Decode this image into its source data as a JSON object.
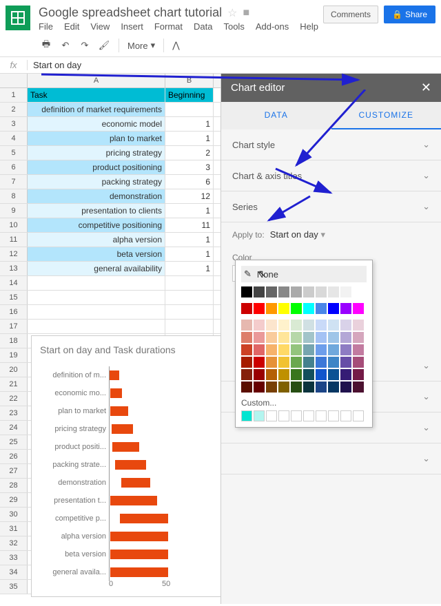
{
  "doc": {
    "title": "Google spreadsheet chart tutorial"
  },
  "menubar": {
    "file": "File",
    "edit": "Edit",
    "view": "View",
    "insert": "Insert",
    "format": "Format",
    "data": "Data",
    "tools": "Tools",
    "addons": "Add-ons",
    "help": "Help"
  },
  "buttons": {
    "comments": "Comments",
    "share": "Share"
  },
  "toolbar": {
    "more": "More"
  },
  "fx": {
    "value": "Start on day"
  },
  "columns": {
    "a": "A",
    "b": "B"
  },
  "table": {
    "header": {
      "task": "Task",
      "beginning": "Beginning"
    },
    "rows": [
      {
        "task": "definition of market requirements",
        "beg": ""
      },
      {
        "task": "economic model",
        "beg": "1"
      },
      {
        "task": "plan to market",
        "beg": "1"
      },
      {
        "task": "pricing strategy",
        "beg": "2"
      },
      {
        "task": "product positioning",
        "beg": "3"
      },
      {
        "task": "packing strategy",
        "beg": "6"
      },
      {
        "task": "demonstration",
        "beg": "12"
      },
      {
        "task": "presentation to clients",
        "beg": "1"
      },
      {
        "task": "competitive positioning",
        "beg": "11"
      },
      {
        "task": "alpha version",
        "beg": "1"
      },
      {
        "task": "beta version",
        "beg": "1"
      },
      {
        "task": "general availability",
        "beg": "1"
      }
    ]
  },
  "chart_data": {
    "type": "bar",
    "title": "Start on day and Task durations",
    "categories": [
      "definition of m...",
      "economic mo...",
      "plan to market",
      "pricing strategy",
      "product positi...",
      "packing strate...",
      "demonstration",
      "presentation t...",
      "competitive p...",
      "alpha version",
      "beta version",
      "general availa..."
    ],
    "series": [
      {
        "name": "Start on day",
        "values": [
          0,
          1,
          1,
          2,
          3,
          6,
          12,
          1,
          11,
          1,
          1,
          1
        ]
      },
      {
        "name": "Task durations",
        "values": [
          10,
          12,
          18,
          22,
          28,
          32,
          30,
          48,
          50,
          60,
          60,
          60
        ]
      }
    ],
    "xlabel": "",
    "ylabel": "",
    "xlim": [
      0,
      100
    ],
    "xticks": [
      "0",
      "50"
    ]
  },
  "editor": {
    "title": "Chart editor",
    "tabs": {
      "data": "DATA",
      "customize": "CUSTOMIZE"
    },
    "sections": {
      "chart_style": "Chart style",
      "axis_titles": "Chart & axis titles",
      "series": "Series"
    },
    "apply_to_label": "Apply to:",
    "apply_to_value": "Start on day",
    "color_label": "Color",
    "color_value": "None",
    "collapsed": [
      "",
      "",
      "",
      ""
    ]
  },
  "color_picker": {
    "none": "None",
    "custom": "Custom...",
    "grays": [
      "#000000",
      "#444444",
      "#666666",
      "#888888",
      "#aaaaaa",
      "#cccccc",
      "#d9d9d9",
      "#e6e6e6",
      "#f2f2f2",
      "#ffffff"
    ],
    "main": [
      "#cc0000",
      "#ff0000",
      "#ff9900",
      "#ffff00",
      "#00ff00",
      "#00ffff",
      "#4a86e8",
      "#0000ff",
      "#9900ff",
      "#ff00ff"
    ],
    "tints": [
      [
        "#e6b8af",
        "#f4cccc",
        "#fce5cd",
        "#fff2cc",
        "#d9ead3",
        "#d0e0e3",
        "#c9daf8",
        "#cfe2f3",
        "#d9d2e9",
        "#ead1dc"
      ],
      [
        "#dd7e6b",
        "#ea9999",
        "#f9cb9c",
        "#ffe599",
        "#b6d7a8",
        "#a2c4c9",
        "#a4c2f4",
        "#9fc5e8",
        "#b4a7d6",
        "#d5a6bd"
      ],
      [
        "#cc4125",
        "#e06666",
        "#f6b26b",
        "#ffd966",
        "#93c47d",
        "#76a5af",
        "#6d9eeb",
        "#6fa8dc",
        "#8e7cc3",
        "#c27ba0"
      ],
      [
        "#a61c00",
        "#cc0000",
        "#e69138",
        "#f1c232",
        "#6aa84f",
        "#45818e",
        "#3c78d8",
        "#3d85c6",
        "#674ea7",
        "#a64d79"
      ],
      [
        "#85200c",
        "#990000",
        "#b45f06",
        "#bf9000",
        "#38761d",
        "#134f5c",
        "#1155cc",
        "#0b5394",
        "#351c75",
        "#741b47"
      ],
      [
        "#5b0f00",
        "#660000",
        "#783f04",
        "#7f6000",
        "#274e13",
        "#0c343d",
        "#1c4587",
        "#073763",
        "#20124d",
        "#4c1130"
      ]
    ],
    "custom_swatches": [
      "#00e5d1",
      "#b3f5ef"
    ]
  }
}
